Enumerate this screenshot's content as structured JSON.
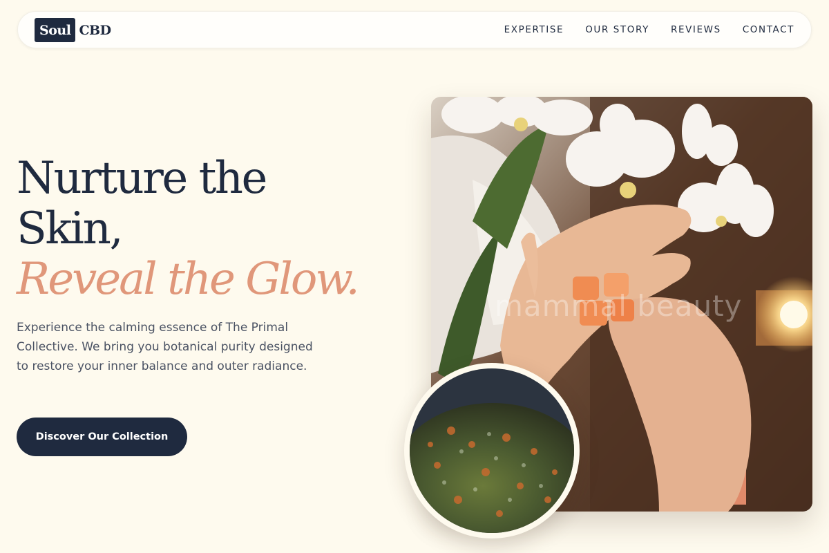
{
  "nav": {
    "logo_box": "Soul",
    "logo_text": "CBD",
    "links": [
      "EXPERTISE",
      "OUR STORY",
      "REVIEWS",
      "CONTACT"
    ]
  },
  "hero": {
    "headline_line1": "Nurture the",
    "headline_line2": "Skin,",
    "headline_accent": "Reveal the Glow.",
    "description": "Experience the calming essence of The Primal Collective. We bring you botanical purity designed to restore your inner balance and outer radiance.",
    "cta_label": "Discover Our Collection",
    "image_watermark": "mammal beauty"
  },
  "colors": {
    "background": "#fefaee",
    "navy": "#1f2a3f",
    "accent_peach": "#e0977a"
  }
}
